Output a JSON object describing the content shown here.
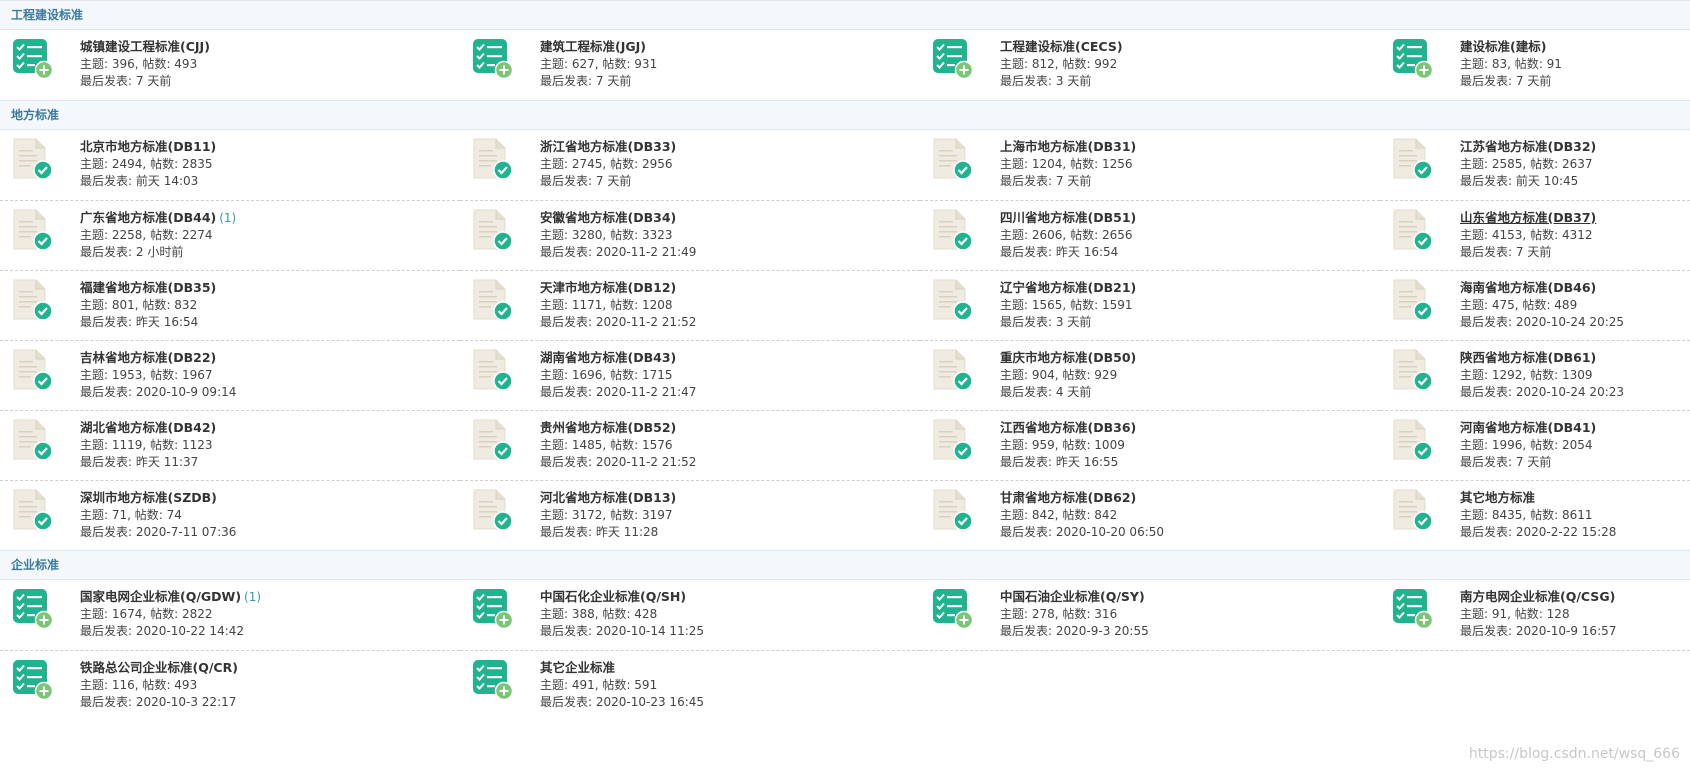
{
  "labels": {
    "topic": "主题",
    "posts": "帖数",
    "last": "最后发表"
  },
  "categories": [
    {
      "title": "工程建设标准",
      "icon": "checklist-plus-icon",
      "forums": [
        {
          "name": "城镇建设工程标准(CJJ)",
          "topics": "396",
          "posts": "493",
          "last": "7 天前"
        },
        {
          "name": "建筑工程标准(JGJ)",
          "topics": "627",
          "posts": "931",
          "last": "7 天前"
        },
        {
          "name": "工程建设标准(CECS)",
          "topics": "812",
          "posts": "992",
          "last": "3 天前"
        },
        {
          "name": "建设标准(建标)",
          "topics": "83",
          "posts": "91",
          "last": "7 天前"
        }
      ]
    },
    {
      "title": "地方标准",
      "icon": "document-check-icon",
      "forums": [
        {
          "name": "北京市地方标准(DB11)",
          "topics": "2494",
          "posts": "2835",
          "last": "前天 14:03"
        },
        {
          "name": "浙江省地方标准(DB33)",
          "topics": "2745",
          "posts": "2956",
          "last": "7 天前"
        },
        {
          "name": "上海市地方标准(DB31)",
          "topics": "1204",
          "posts": "1256",
          "last": "7 天前"
        },
        {
          "name": "江苏省地方标准(DB32)",
          "topics": "2585",
          "posts": "2637",
          "last": "前天 10:45"
        },
        {
          "name": "广东省地方标准(DB44)",
          "new": "(1)",
          "topics": "2258",
          "posts": "2274",
          "last": "2 小时前"
        },
        {
          "name": "安徽省地方标准(DB34)",
          "topics": "3280",
          "posts": "3323",
          "last": "2020-11-2 21:49"
        },
        {
          "name": "四川省地方标准(DB51)",
          "topics": "2606",
          "posts": "2656",
          "last": "昨天 16:54"
        },
        {
          "name": "山东省地方标准(DB37)",
          "underline": true,
          "topics": "4153",
          "posts": "4312",
          "last": "7 天前"
        },
        {
          "name": "福建省地方标准(DB35)",
          "topics": "801",
          "posts": "832",
          "last": "昨天 16:54"
        },
        {
          "name": "天津市地方标准(DB12)",
          "topics": "1171",
          "posts": "1208",
          "last": "2020-11-2 21:52"
        },
        {
          "name": "辽宁省地方标准(DB21)",
          "topics": "1565",
          "posts": "1591",
          "last": "3 天前"
        },
        {
          "name": "海南省地方标准(DB46)",
          "topics": "475",
          "posts": "489",
          "last": "2020-10-24 20:25"
        },
        {
          "name": "吉林省地方标准(DB22)",
          "topics": "1953",
          "posts": "1967",
          "last": "2020-10-9 09:14"
        },
        {
          "name": "湖南省地方标准(DB43)",
          "topics": "1696",
          "posts": "1715",
          "last": "2020-11-2 21:47"
        },
        {
          "name": "重庆市地方标准(DB50)",
          "topics": "904",
          "posts": "929",
          "last": "4 天前"
        },
        {
          "name": "陕西省地方标准(DB61)",
          "topics": "1292",
          "posts": "1309",
          "last": "2020-10-24 20:23"
        },
        {
          "name": "湖北省地方标准(DB42)",
          "topics": "1119",
          "posts": "1123",
          "last": "昨天 11:37"
        },
        {
          "name": "贵州省地方标准(DB52)",
          "topics": "1485",
          "posts": "1576",
          "last": "2020-11-2 21:52"
        },
        {
          "name": "江西省地方标准(DB36)",
          "topics": "959",
          "posts": "1009",
          "last": "昨天 16:55"
        },
        {
          "name": "河南省地方标准(DB41)",
          "topics": "1996",
          "posts": "2054",
          "last": "7 天前"
        },
        {
          "name": "深圳市地方标准(SZDB)",
          "topics": "71",
          "posts": "74",
          "last": "2020-7-11 07:36"
        },
        {
          "name": "河北省地方标准(DB13)",
          "topics": "3172",
          "posts": "3197",
          "last": "昨天 11:28"
        },
        {
          "name": "甘肃省地方标准(DB62)",
          "topics": "842",
          "posts": "842",
          "last": "2020-10-20 06:50"
        },
        {
          "name": "其它地方标准",
          "topics": "8435",
          "posts": "8611",
          "last": "2020-2-22 15:28"
        }
      ]
    },
    {
      "title": "企业标准",
      "icon": "checklist-plus-icon",
      "forums": [
        {
          "name": "国家电网企业标准(Q/GDW)",
          "new": "(1)",
          "topics": "1674",
          "posts": "2822",
          "last": "2020-10-22 14:42"
        },
        {
          "name": "中国石化企业标准(Q/SH)",
          "topics": "388",
          "posts": "428",
          "last": "2020-10-14 11:25"
        },
        {
          "name": "中国石油企业标准(Q/SY)",
          "topics": "278",
          "posts": "316",
          "last": "2020-9-3 20:55"
        },
        {
          "name": "南方电网企业标准(Q/CSG)",
          "topics": "91",
          "posts": "128",
          "last": "2020-10-9 16:57"
        },
        {
          "name": "铁路总公司企业标准(Q/CR)",
          "topics": "116",
          "posts": "493",
          "last": "2020-10-3 22:17"
        },
        {
          "name": "其它企业标准",
          "topics": "491",
          "posts": "591",
          "last": "2020-10-23 16:45"
        }
      ]
    }
  ],
  "watermark": "https://blog.csdn.net/wsq_666",
  "colors": {
    "accent": "#1fb38f",
    "header_text": "#3b7b9e",
    "header_bg": "#f5f8fa"
  }
}
